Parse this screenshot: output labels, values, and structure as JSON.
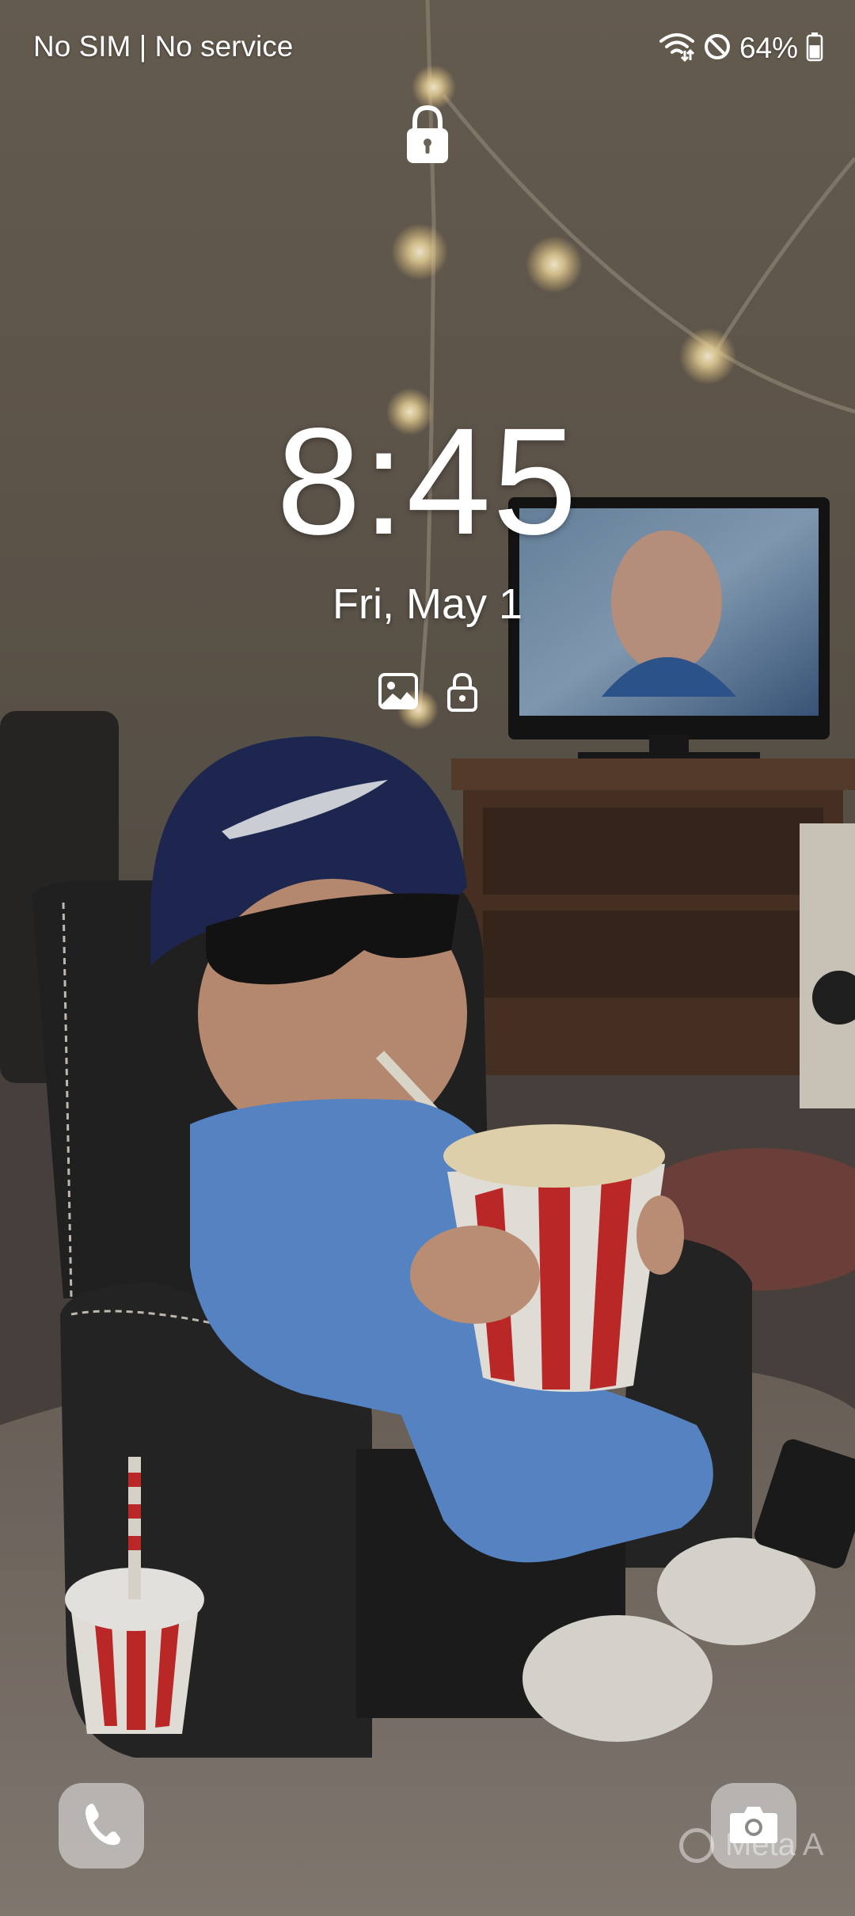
{
  "status_bar": {
    "carrier": "No SIM | No service",
    "battery_percent": "64%",
    "icons": [
      "wifi-calling-icon",
      "do-not-disturb-icon",
      "battery-icon"
    ],
    "battery_level": 0.64
  },
  "lock_screen": {
    "lock_icon": "lock-icon",
    "time": "8:45",
    "date": "Fri, May 1",
    "widget_icons": [
      "gallery-icon",
      "lock-icon"
    ]
  },
  "shortcuts": {
    "left": "phone-icon",
    "right": "camera-icon"
  },
  "watermark": {
    "text": "Meta A"
  },
  "colors": {
    "text": "#ffffff",
    "shortcut_bg": "rgba(235,235,235,0.55)"
  }
}
